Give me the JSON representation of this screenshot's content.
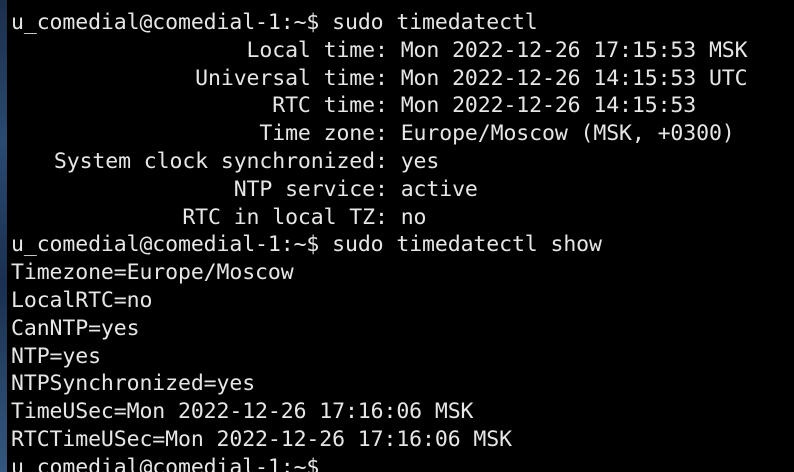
{
  "terminal": {
    "prompt": "u_comedial@comedial-1:~$",
    "lines": [
      {
        "kind": "command",
        "command": "sudo timedatectl"
      },
      {
        "kind": "field",
        "key": "Local time",
        "value": "Mon 2022-12-26 17:15:53 MSK"
      },
      {
        "kind": "field",
        "key": "Universal time",
        "value": "Mon 2022-12-26 14:15:53 UTC"
      },
      {
        "kind": "field",
        "key": "RTC time",
        "value": "Mon 2022-12-26 14:15:53"
      },
      {
        "kind": "field",
        "key": "Time zone",
        "value": "Europe/Moscow (MSK, +0300)"
      },
      {
        "kind": "field",
        "key": "System clock synchronized",
        "value": "yes"
      },
      {
        "kind": "field",
        "key": "NTP service",
        "value": "active"
      },
      {
        "kind": "field",
        "key": "RTC in local TZ",
        "value": "no"
      },
      {
        "kind": "command",
        "command": "sudo timedatectl show"
      },
      {
        "kind": "text",
        "text": "Timezone=Europe/Moscow"
      },
      {
        "kind": "text",
        "text": "LocalRTC=no"
      },
      {
        "kind": "text",
        "text": "CanNTP=yes"
      },
      {
        "kind": "text",
        "text": "NTP=yes"
      },
      {
        "kind": "text",
        "text": "NTPSynchronized=yes"
      },
      {
        "kind": "text",
        "text": "TimeUSec=Mon 2022-12-26 17:16:06 MSK"
      },
      {
        "kind": "text",
        "text": "RTCTimeUSec=Mon 2022-12-26 17:16:06 MSK"
      },
      {
        "kind": "command",
        "command": ""
      }
    ]
  }
}
